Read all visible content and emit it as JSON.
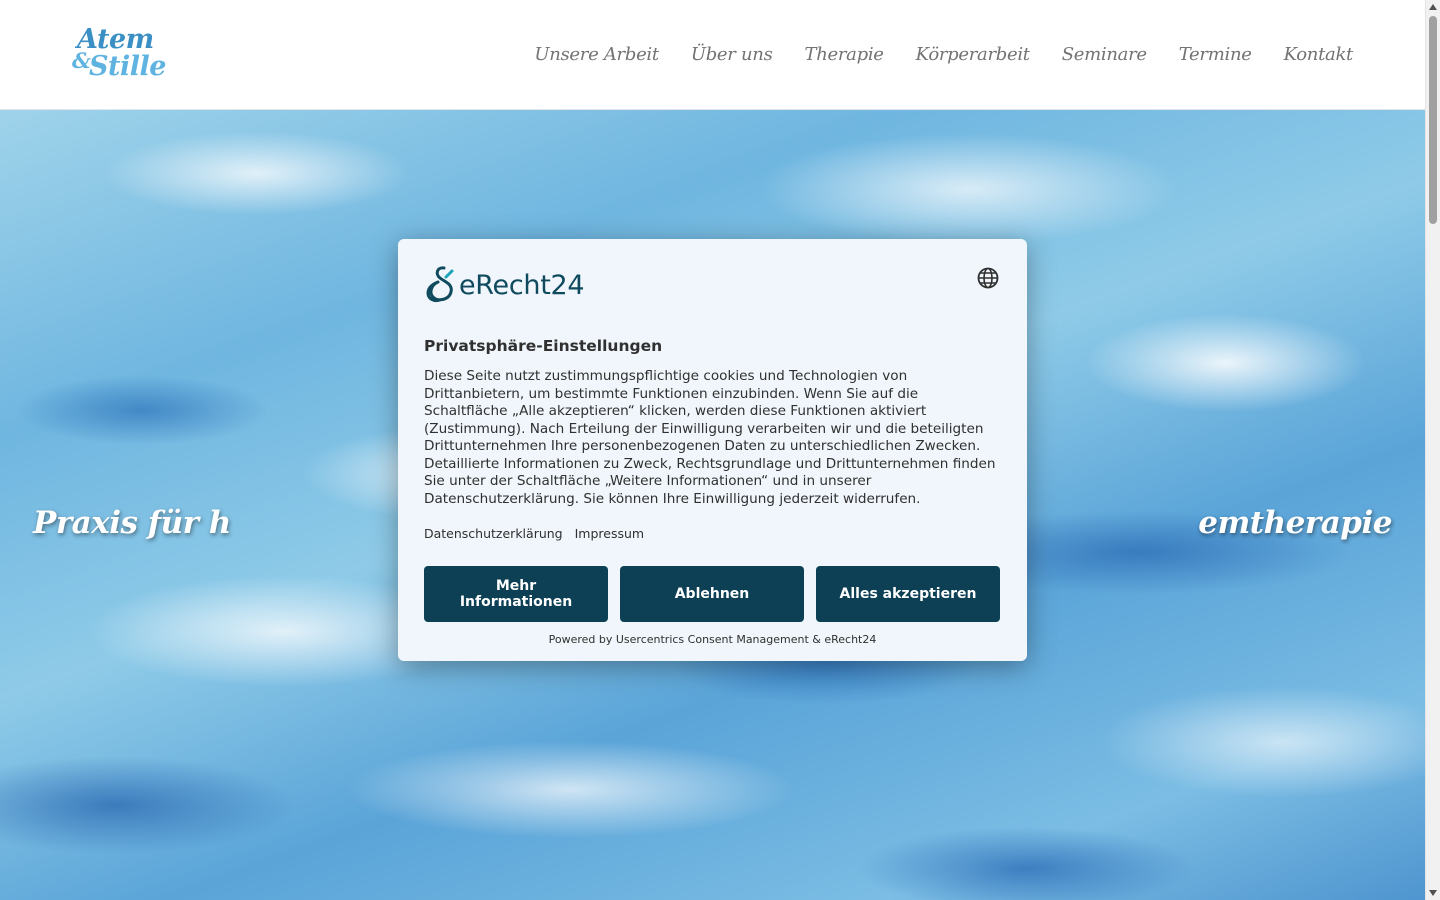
{
  "header": {
    "logo": {
      "line1": "Atem",
      "ampersand": "&",
      "line2": "Stille"
    },
    "nav": [
      {
        "label": "Unsere Arbeit"
      },
      {
        "label": "Über uns"
      },
      {
        "label": "Therapie"
      },
      {
        "label": "Körperarbeit"
      },
      {
        "label": "Seminare"
      },
      {
        "label": "Termine"
      },
      {
        "label": "Kontakt"
      }
    ]
  },
  "hero": {
    "tagline": "Praxis für h                                                                                              emtherapie"
  },
  "consent": {
    "brand": "eRecht24",
    "language_icon": "globe-icon",
    "title": "Privatsphäre-Einstellungen",
    "text": "Diese Seite nutzt zustimmungspflichtige cookies und Technologien von Drittanbietern, um bestimmte Funktionen einzubinden. Wenn Sie auf die Schaltfläche „Alle akzeptieren“ klicken, werden diese Funktionen aktiviert (Zustimmung). Nach Erteilung der Einwilligung verarbeiten wir und die beteiligten Drittunternehmen Ihre personenbezogenen Daten zu unterschiedlichen Zwecken. Detaillierte Informationen zu Zweck, Rechtsgrundlage und Drittunternehmen finden Sie unter der Schaltfläche „Weitere Informationen“ und in unserer Datenschutzerklärung. Sie können Ihre Einwilligung jederzeit widerrufen.",
    "links": {
      "privacy": "Datenschutzerklärung",
      "imprint": "Impressum"
    },
    "buttons": {
      "more_info": "Mehr Informationen",
      "decline": "Ablehnen",
      "accept_all": "Alles akzeptieren"
    },
    "powered_by": "Powered by Usercentrics Consent Management & eRecht24"
  },
  "colors": {
    "button_bg": "#0d3f55",
    "dialog_bg": "#f0f6fb",
    "nav_text": "#737373",
    "logo_dark": "#3a8fc4",
    "logo_light": "#5fb3e0"
  }
}
